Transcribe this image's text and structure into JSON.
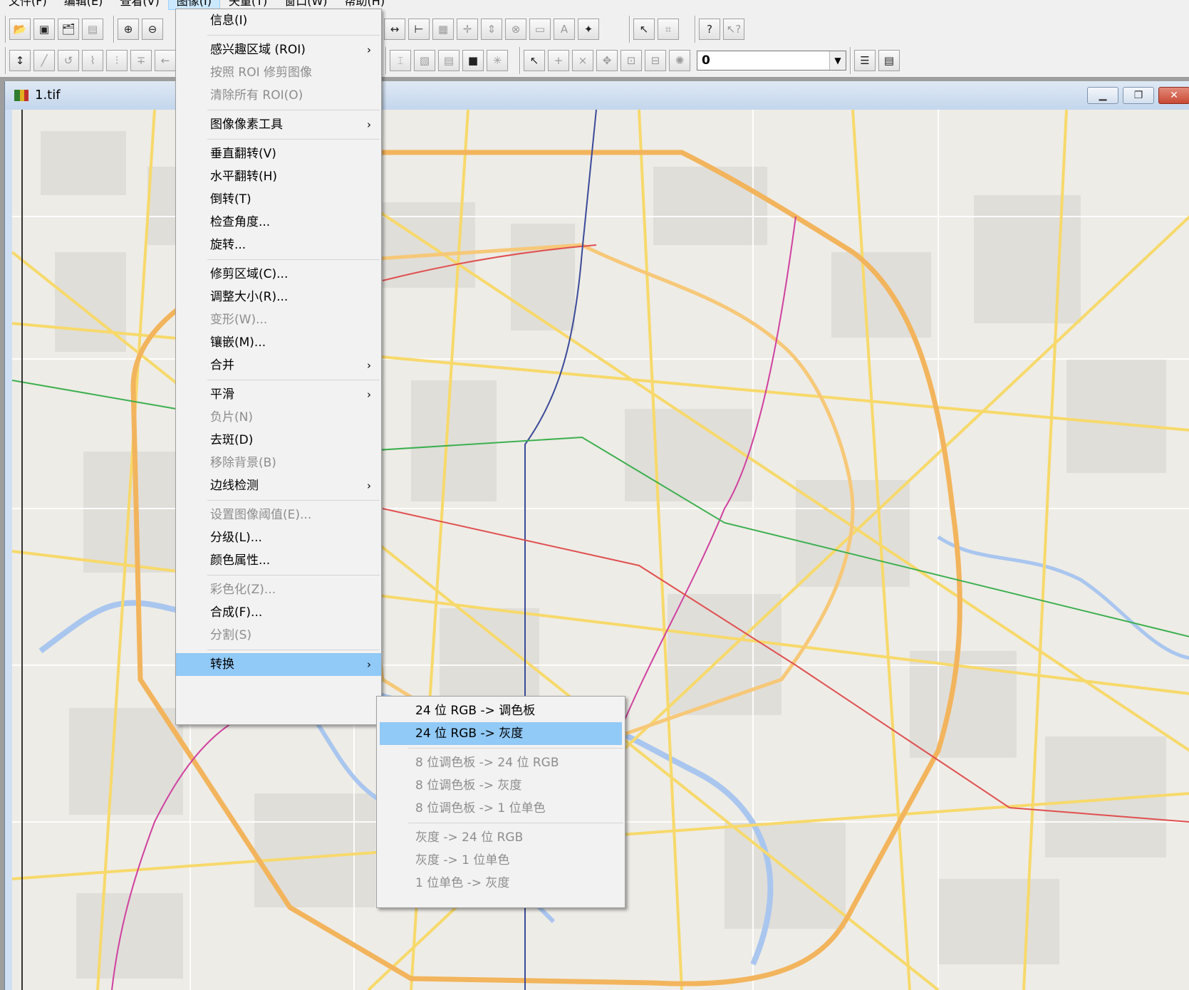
{
  "menubar": {
    "items": [
      {
        "label": "文件(F)"
      },
      {
        "label": "编辑(E)"
      },
      {
        "label": "查看(V)"
      },
      {
        "label": "图像(I)"
      },
      {
        "label": "矢量(T)"
      },
      {
        "label": "窗口(W)"
      },
      {
        "label": "帮助(H)"
      }
    ]
  },
  "toolbar": {
    "combo_value": "0"
  },
  "window": {
    "title": "1.tif",
    "minimize_icon": "minimize-icon",
    "restore_icon": "restore-icon",
    "close_icon": "close-icon"
  },
  "image_menu": {
    "items": [
      {
        "label": "信息(I)",
        "enabled": true
      },
      {
        "label": "感兴趣区域 (ROI)",
        "enabled": true,
        "submenu": true
      },
      {
        "label": "按照 ROI 修剪图像",
        "enabled": false
      },
      {
        "label": "清除所有 ROI(O)",
        "enabled": false
      },
      {
        "label": "图像像素工具",
        "enabled": true,
        "submenu": true
      },
      {
        "label": "垂直翻转(V)",
        "enabled": true
      },
      {
        "label": "水平翻转(H)",
        "enabled": true
      },
      {
        "label": "倒转(T)",
        "enabled": true
      },
      {
        "label": "检查角度...",
        "enabled": true
      },
      {
        "label": "旋转...",
        "enabled": true
      },
      {
        "label": "修剪区域(C)...",
        "enabled": true
      },
      {
        "label": "调整大小(R)...",
        "enabled": true
      },
      {
        "label": "变形(W)...",
        "enabled": false
      },
      {
        "label": "镶嵌(M)...",
        "enabled": true
      },
      {
        "label": "合并",
        "enabled": true,
        "submenu": true
      },
      {
        "label": "平滑",
        "enabled": true,
        "submenu": true
      },
      {
        "label": "负片(N)",
        "enabled": false
      },
      {
        "label": "去斑(D)",
        "enabled": true
      },
      {
        "label": "移除背景(B)",
        "enabled": false
      },
      {
        "label": "边线检测",
        "enabled": true,
        "submenu": true
      },
      {
        "label": "设置图像阈值(E)...",
        "enabled": false
      },
      {
        "label": "分级(L)...",
        "enabled": true
      },
      {
        "label": "颜色属性...",
        "enabled": true
      },
      {
        "label": "彩色化(Z)...",
        "enabled": false
      },
      {
        "label": "合成(F)...",
        "enabled": true
      },
      {
        "label": "分割(S)",
        "enabled": false
      },
      {
        "label": "转换",
        "enabled": true,
        "submenu": true,
        "highlighted": true
      }
    ]
  },
  "convert_menu": {
    "items": [
      {
        "label": "24 位 RGB -> 调色板",
        "enabled": true
      },
      {
        "label": "24 位 RGB -> 灰度",
        "enabled": true,
        "highlighted": true
      },
      {
        "label": "8 位调色板 -> 24 位 RGB",
        "enabled": false
      },
      {
        "label": "8 位调色板 -> 灰度",
        "enabled": false
      },
      {
        "label": "8 位调色板 -> 1 位单色",
        "enabled": false
      },
      {
        "label": "灰度 -> 24 位 RGB",
        "enabled": false
      },
      {
        "label": "灰度 -> 1 位单色",
        "enabled": false
      },
      {
        "label": "1 位单色 -> 灰度",
        "enabled": false
      }
    ]
  },
  "colors": {
    "menu_highlight": "#91c9f7",
    "map_background": "#eeece6",
    "ring_road": "#f2b45c",
    "major_road": "#f7d96b",
    "river": "#a9c6ef",
    "block": "#dddcd6"
  }
}
